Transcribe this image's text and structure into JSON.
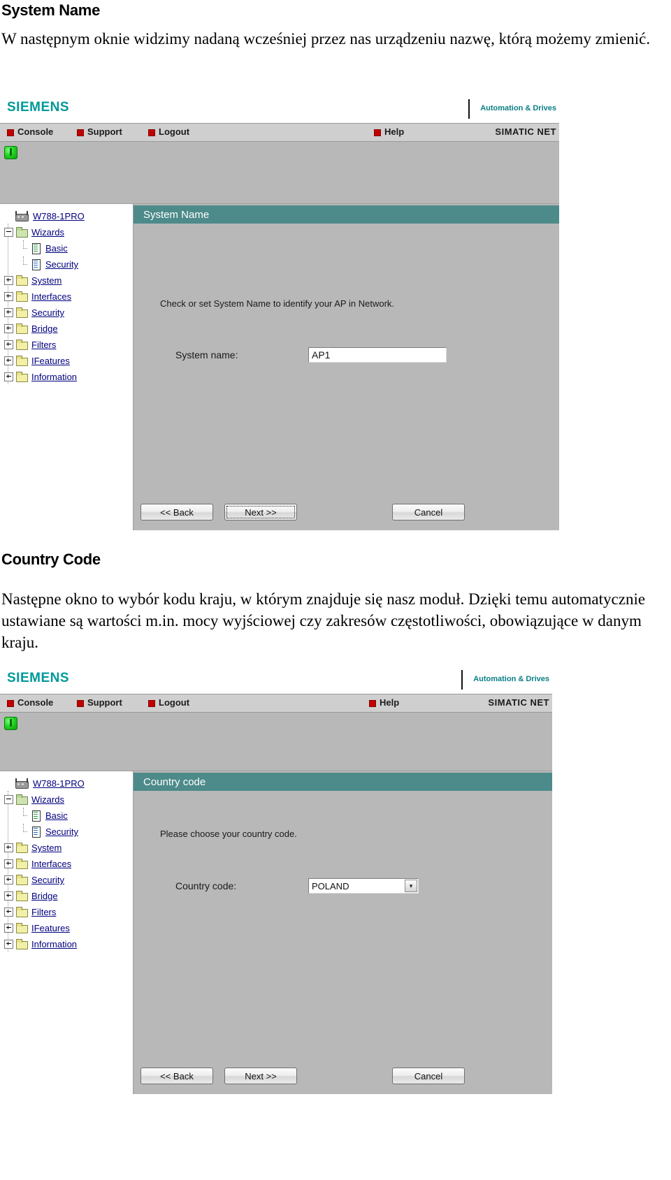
{
  "document": {
    "section1": {
      "heading": "System Name",
      "paragraph": "W następnym oknie widzimy nadaną wcześniej przez nas urządzeniu nazwę, którą możemy zmienić."
    },
    "section2": {
      "heading": "Country Code",
      "paragraph": "Następne okno to wybór kodu kraju, w którym znajduje się nasz moduł. Dzięki temu automatycznie ustawiane są wartości m.in. mocy wyjściowej czy zakresów częstotliwości, obowiązujące w danym kraju."
    }
  },
  "screenshot1": {
    "brand": {
      "logo": "SIEMENS",
      "tagline": "Automation & Drives"
    },
    "menu": {
      "console": "Console",
      "support": "Support",
      "logout": "Logout",
      "help": "Help",
      "product": "SIMATIC NET"
    },
    "tree": [
      {
        "label": "W788-1PRO",
        "icon": "device-icon",
        "expander": "none",
        "level": 0
      },
      {
        "label": "Wizards",
        "icon": "folder-open-icon",
        "expander": "minus",
        "level": 1
      },
      {
        "label": "Basic",
        "icon": "page-green-icon",
        "expander": "dots",
        "level": 2
      },
      {
        "label": "Security",
        "icon": "page-blue-icon",
        "expander": "dots",
        "level": 2
      },
      {
        "label": "System",
        "icon": "folder-icon",
        "expander": "plus",
        "level": 1
      },
      {
        "label": "Interfaces",
        "icon": "folder-icon",
        "expander": "plus",
        "level": 1
      },
      {
        "label": "Security",
        "icon": "folder-icon",
        "expander": "plus",
        "level": 1
      },
      {
        "label": "Bridge",
        "icon": "folder-icon",
        "expander": "plus",
        "level": 1
      },
      {
        "label": "Filters",
        "icon": "folder-icon",
        "expander": "plus",
        "level": 1
      },
      {
        "label": "IFeatures",
        "icon": "folder-icon",
        "expander": "plus",
        "level": 1
      },
      {
        "label": "Information",
        "icon": "folder-icon",
        "expander": "plus",
        "level": 1
      }
    ],
    "panel": {
      "title": "System Name",
      "description": "Check or set System Name to identify your AP in Network.",
      "field_label": "System name:",
      "field_value": "AP1"
    },
    "buttons": {
      "back": "<< Back",
      "next": "Next >>",
      "cancel": "Cancel"
    }
  },
  "screenshot2": {
    "brand": {
      "logo": "SIEMENS",
      "tagline": "Automation & Drives"
    },
    "menu": {
      "console": "Console",
      "support": "Support",
      "logout": "Logout",
      "help": "Help",
      "product": "SIMATIC NET"
    },
    "tree": [
      {
        "label": "W788-1PRO",
        "icon": "device-icon",
        "expander": "none",
        "level": 0
      },
      {
        "label": "Wizards",
        "icon": "folder-open-icon",
        "expander": "minus",
        "level": 1
      },
      {
        "label": "Basic",
        "icon": "page-green-icon",
        "expander": "dots",
        "level": 2
      },
      {
        "label": "Security",
        "icon": "page-blue-icon",
        "expander": "dots",
        "level": 2
      },
      {
        "label": "System",
        "icon": "folder-icon",
        "expander": "plus",
        "level": 1
      },
      {
        "label": "Interfaces",
        "icon": "folder-icon",
        "expander": "plus",
        "level": 1
      },
      {
        "label": "Security",
        "icon": "folder-icon",
        "expander": "plus",
        "level": 1
      },
      {
        "label": "Bridge",
        "icon": "folder-icon",
        "expander": "plus",
        "level": 1
      },
      {
        "label": "Filters",
        "icon": "folder-icon",
        "expander": "plus",
        "level": 1
      },
      {
        "label": "IFeatures",
        "icon": "folder-icon",
        "expander": "plus",
        "level": 1
      },
      {
        "label": "Information",
        "icon": "folder-icon",
        "expander": "plus",
        "level": 1
      }
    ],
    "panel": {
      "title": "Country code",
      "description": "Please choose your country code.",
      "field_label": "Country code:",
      "field_value": "POLAND",
      "dropdown_arrow": "▾"
    },
    "buttons": {
      "back": "<< Back",
      "next": "Next >>",
      "cancel": "Cancel"
    }
  },
  "colors": {
    "siemens_teal": "#009999",
    "panel_header": "#4d8a8a",
    "menu_bullet": "#c00000",
    "led_green": "#24d424",
    "chrome_gray": "#b8b8b8"
  }
}
